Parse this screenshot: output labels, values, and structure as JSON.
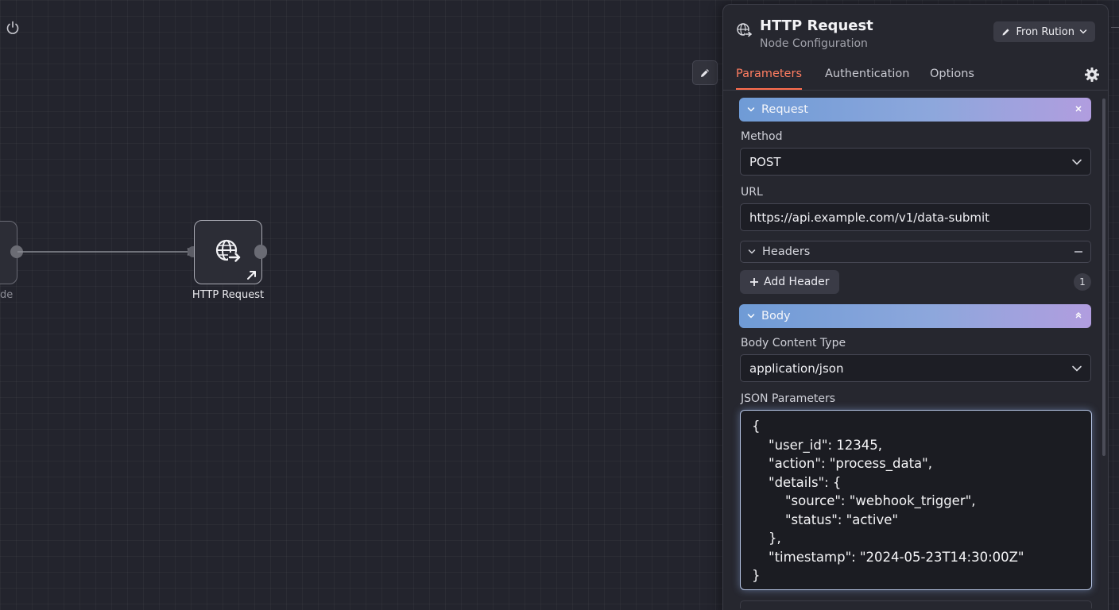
{
  "canvas": {
    "prev_node_label": "de",
    "http_node_label": "HTTP Request"
  },
  "panel": {
    "title": "HTTP Request",
    "subtitle": "Node Configuration",
    "mode_label": "Fron Rution",
    "tabs": [
      {
        "label": "Parameters",
        "active": true
      },
      {
        "label": "Authentication",
        "active": false
      },
      {
        "label": "Options",
        "active": false
      }
    ],
    "request_section": {
      "title": "Request",
      "method_label": "Method",
      "method_value": "POST",
      "url_label": "URL",
      "url_value": "https://api.example.com/v1/data-submit"
    },
    "headers_section": {
      "title": "Headers",
      "add_label": "Add Header",
      "count": "1"
    },
    "body_section": {
      "title": "Body",
      "content_type_label": "Body Content Type",
      "content_type_value": "application/json",
      "json_label": "JSON Parameters",
      "json_text": "{\n    \"user_id\": 12345,\n    \"action\": \"process_data\",\n    \"details\": {\n        \"source\": \"webhook_trigger\",\n        \"status\": \"active\"\n    },\n    \"timestamp\": \"2024-05-23T14:30:00Z\"\n}"
    }
  },
  "colors": {
    "accent_tab": "#ff7d61",
    "section_gradient_start": "#6f9bd6",
    "section_gradient_end": "#b19ddf",
    "canvas_bg": "#23242d"
  },
  "icons": {
    "power": "power-icon",
    "globe": "globe-arrow-icon",
    "pencil": "pencil-icon",
    "gear": "gear-icon",
    "chevron": "chevron-down-icon",
    "plus": "plus-icon"
  }
}
